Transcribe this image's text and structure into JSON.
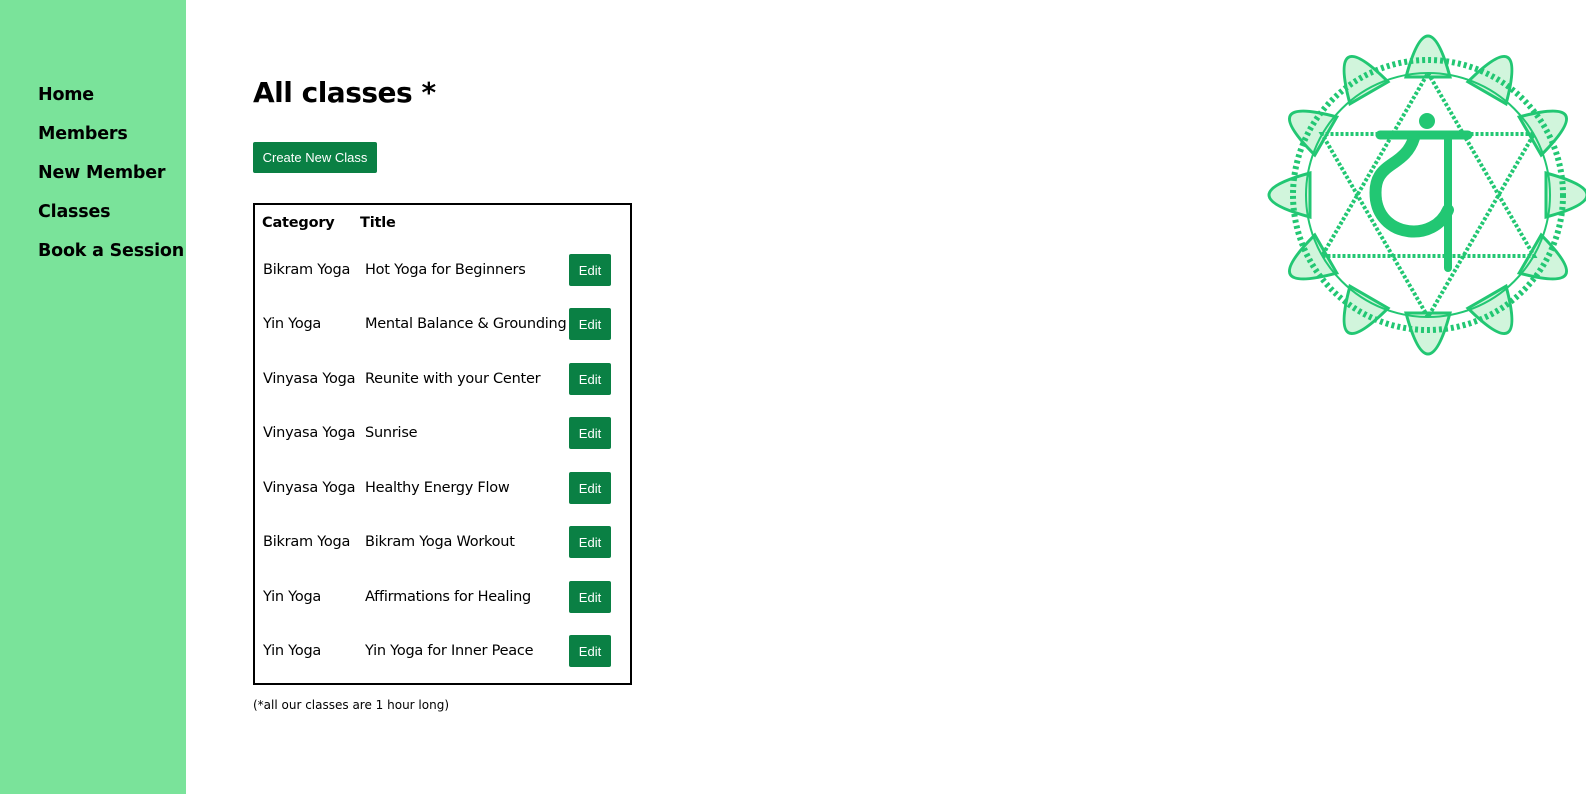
{
  "nav": {
    "items": [
      {
        "label": "Home"
      },
      {
        "label": "Members"
      },
      {
        "label": "New Member"
      },
      {
        "label": "Classes"
      },
      {
        "label": "Book a Session"
      }
    ]
  },
  "page": {
    "title": "All classes *",
    "create_button": "Create New Class",
    "footnote": "(*all our classes are 1 hour long)"
  },
  "table": {
    "headers": {
      "category": "Category",
      "title": "Title"
    },
    "edit_label": "Edit",
    "rows": [
      {
        "category": "Bikram Yoga",
        "title": "Hot Yoga for Beginners"
      },
      {
        "category": "Yin Yoga",
        "title": "Mental Balance & Grounding"
      },
      {
        "category": "Vinyasa Yoga",
        "title": "Reunite with your Center"
      },
      {
        "category": "Vinyasa Yoga",
        "title": "Sunrise"
      },
      {
        "category": "Vinyasa Yoga",
        "title": "Healthy Energy Flow"
      },
      {
        "category": "Bikram Yoga",
        "title": "Bikram Yoga Workout"
      },
      {
        "category": "Yin Yoga",
        "title": "Affirmations for Healing"
      },
      {
        "category": "Yin Yoga",
        "title": "Yin Yoga for Inner Peace"
      }
    ]
  },
  "colors": {
    "sidebar": "#7ae39a",
    "button": "#0a8044",
    "chakra": "#22c773"
  },
  "decor": {
    "chakra_icon": "heart-chakra-icon"
  }
}
